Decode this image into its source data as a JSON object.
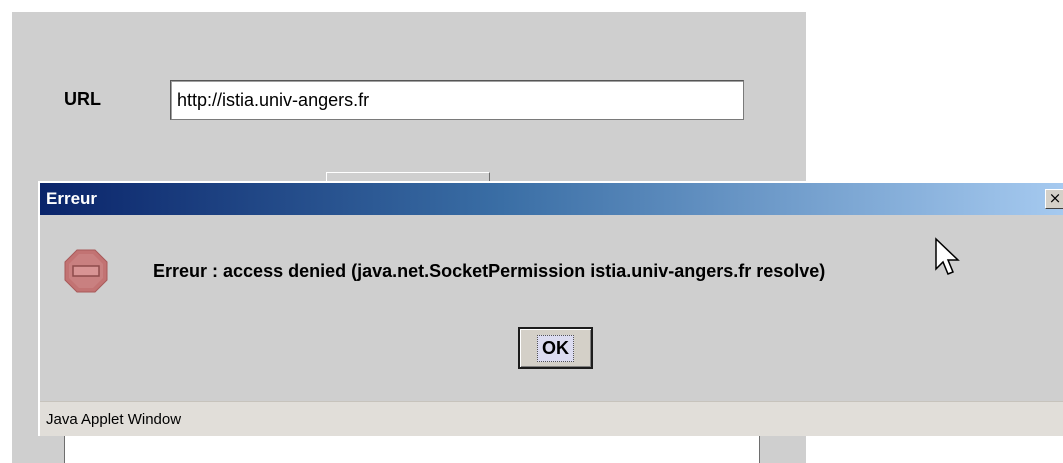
{
  "applet": {
    "url_label": "URL",
    "url_value": "http://istia.univ-angers.fr"
  },
  "dialog": {
    "title": "Erreur",
    "close_glyph": "×",
    "message": "Erreur : access denied (java.net.SocketPermission istia.univ-angers.fr resolve)",
    "ok_label": "OK",
    "status": "Java Applet Window",
    "icon": "stop-sign-icon"
  },
  "colors": {
    "title_gradient_start": "#0a246a",
    "title_gradient_end": "#a6caf0",
    "window_bg": "#cfcfcf",
    "status_bg": "#e1ded9",
    "stop_icon": "#c07070"
  }
}
